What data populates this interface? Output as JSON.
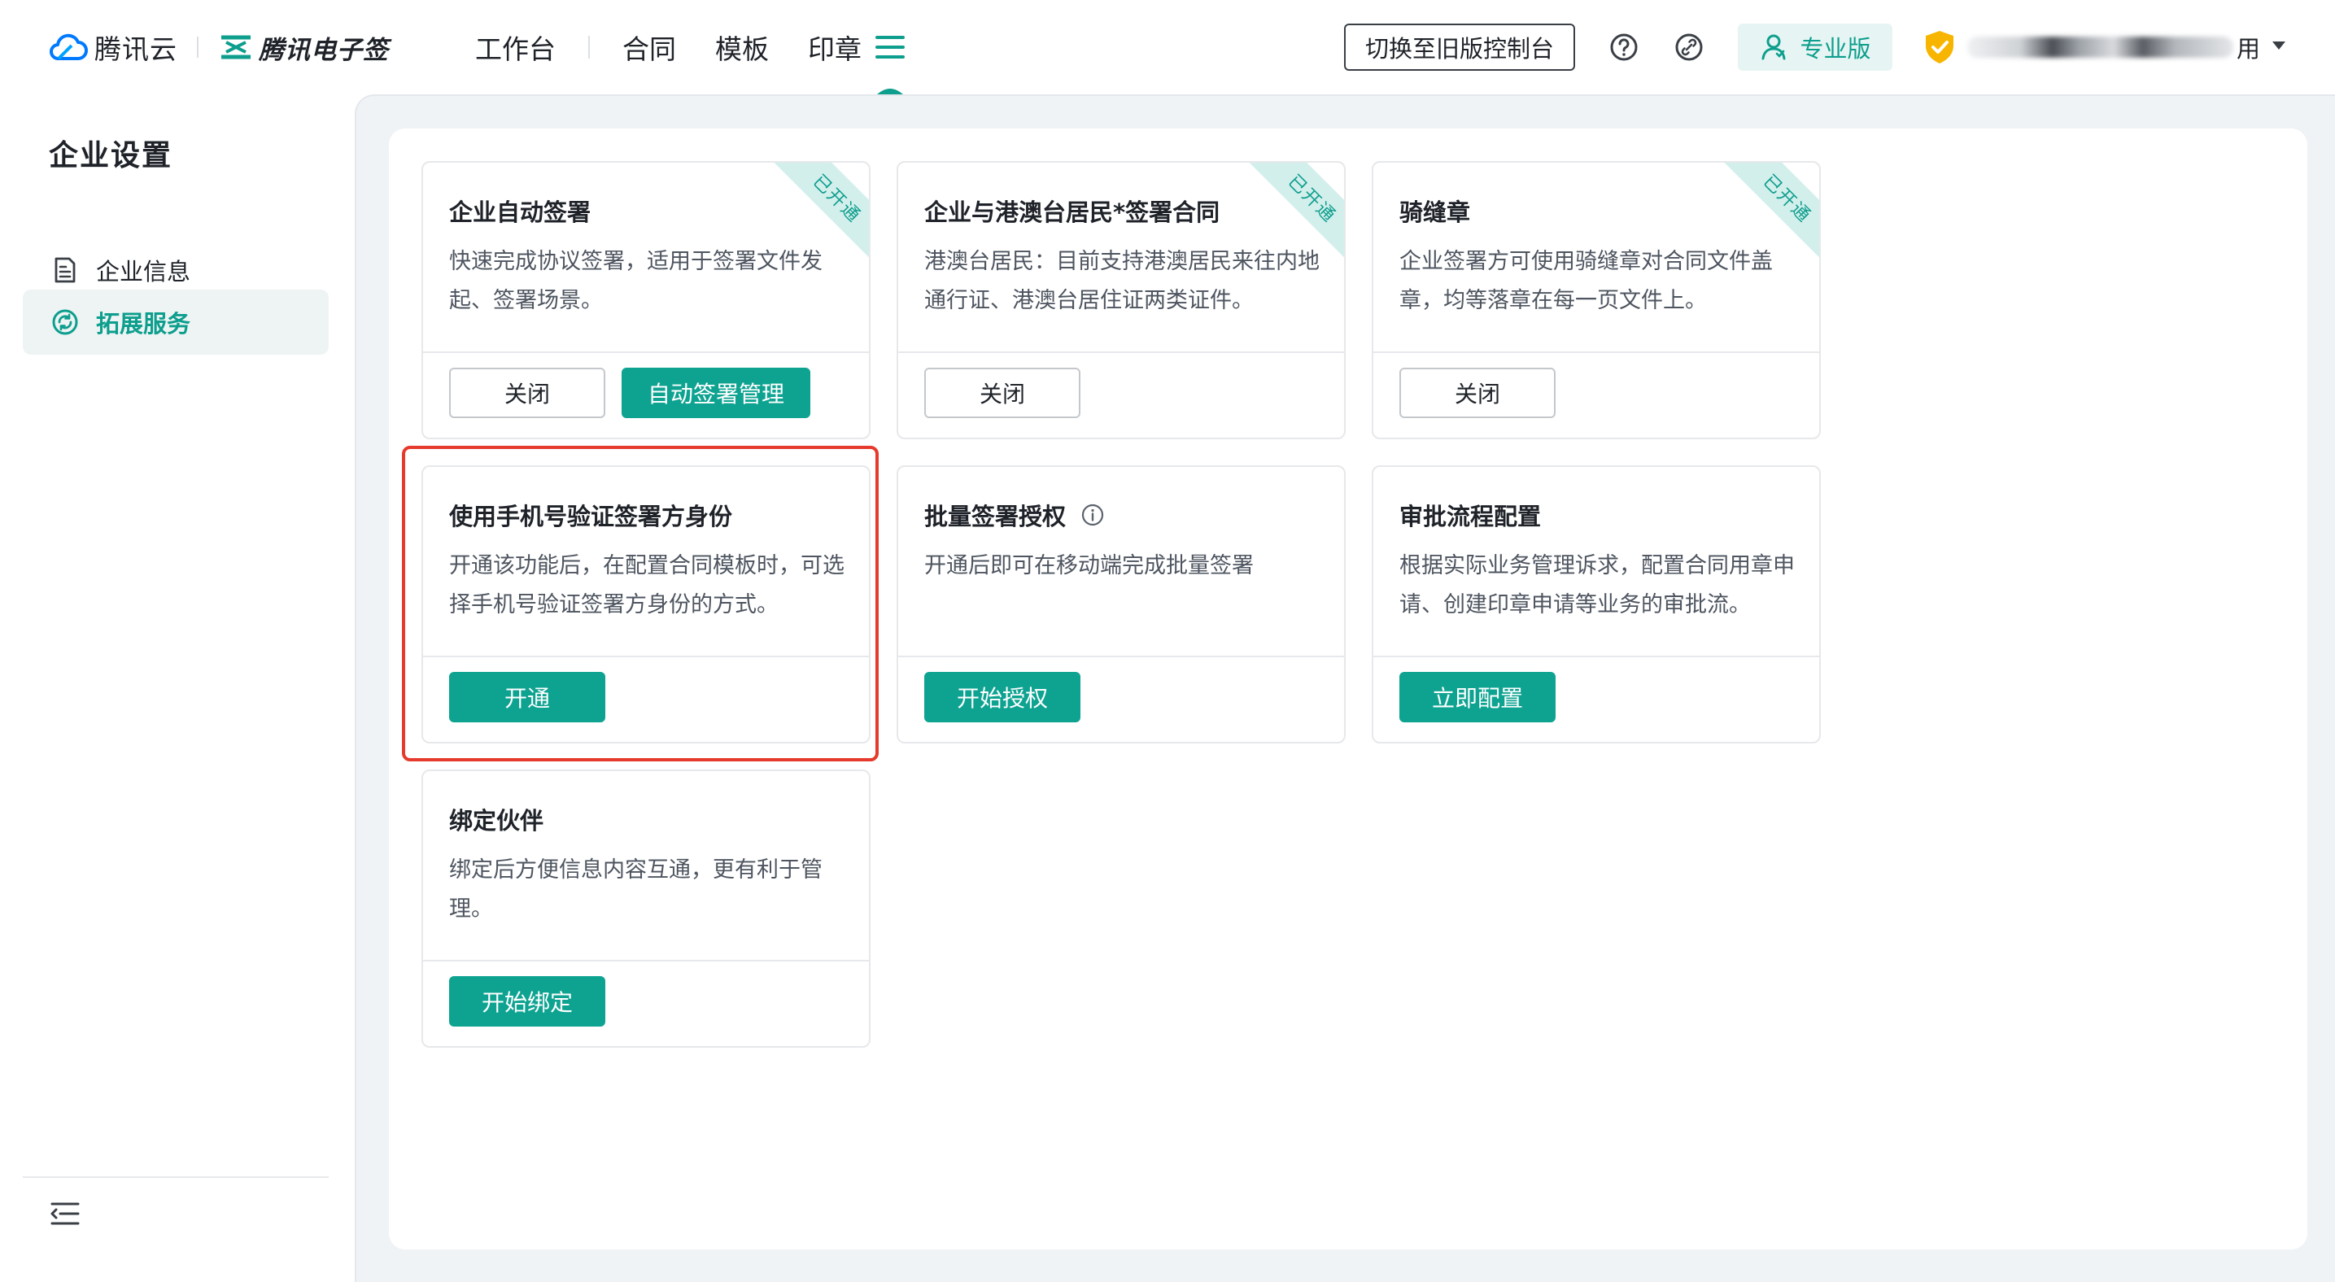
{
  "topbar": {
    "brand_name": "腾讯云",
    "esign_name": "腾讯电子签",
    "nav": [
      "工作台",
      "合同",
      "模板",
      "印章"
    ],
    "menu_icon": "hamburger-menu-icon",
    "switch_label": "切换至旧版控制台",
    "help_icon": "question-circle-icon",
    "link_icon": "link-icon",
    "pro_label": "专业版",
    "account_tail": "用"
  },
  "sidebar": {
    "title": "企业设置",
    "items": [
      {
        "label": "企业信息",
        "icon": "document-icon",
        "active": false
      },
      {
        "label": "拓展服务",
        "icon": "extension-service-icon",
        "active": true
      }
    ]
  },
  "cards": [
    {
      "title": "企业自动签署",
      "desc": "快速完成协议签署，适用于签署文件发起、签署场景。",
      "ribbon": "已开通",
      "buttons": [
        {
          "label": "关闭",
          "style": "outline"
        },
        {
          "label": "自动签署管理",
          "style": "primary"
        }
      ]
    },
    {
      "title": "企业与港澳台居民*签署合同",
      "desc": "港澳台居民：目前支持港澳居民来往内地通行证、港澳台居住证两类证件。",
      "ribbon": "已开通",
      "buttons": [
        {
          "label": "关闭",
          "style": "outline"
        }
      ]
    },
    {
      "title": "骑缝章",
      "desc": "企业签署方可使用骑缝章对合同文件盖章，均等落章在每一页文件上。",
      "ribbon": "已开通",
      "buttons": [
        {
          "label": "关闭",
          "style": "outline"
        }
      ]
    },
    {
      "title": "使用手机号验证签署方身份",
      "desc": "开通该功能后，在配置合同模板时，可选择手机号验证签署方身份的方式。",
      "buttons": [
        {
          "label": "开通",
          "style": "primary"
        }
      ]
    },
    {
      "title": "批量签署授权",
      "info_icon": "info-circle-icon",
      "desc": "开通后即可在移动端完成批量签署",
      "buttons": [
        {
          "label": "开始授权",
          "style": "primary"
        }
      ]
    },
    {
      "title": "审批流程配置",
      "desc": "根据实际业务管理诉求，配置合同用章申请、创建印章申请等业务的审批流。",
      "buttons": [
        {
          "label": "立即配置",
          "style": "primary"
        }
      ]
    },
    {
      "title": "绑定伙伴",
      "desc": "绑定后方便信息内容互通，更有利于管理。",
      "buttons": [
        {
          "label": "开始绑定",
          "style": "primary"
        }
      ]
    }
  ],
  "colors": {
    "accent": "#0ea391",
    "ribbon_bg": "#d3efec",
    "highlight": "#e53a2c",
    "content_bg": "#f0f3f6"
  }
}
